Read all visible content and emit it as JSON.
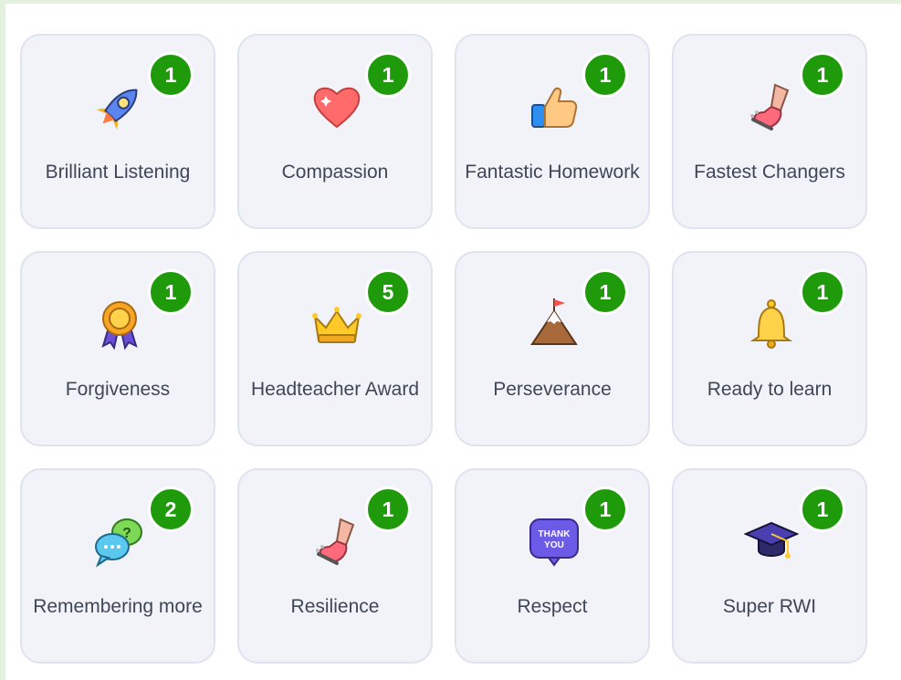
{
  "points": [
    {
      "label": "Brilliant Listening",
      "count": "1",
      "icon": "rocket-icon"
    },
    {
      "label": "Compassion",
      "count": "1",
      "icon": "heart-icon"
    },
    {
      "label": "Fantastic Homework",
      "count": "1",
      "icon": "thumbs-up-icon"
    },
    {
      "label": "Fastest Changers",
      "count": "1",
      "icon": "running-foot-icon"
    },
    {
      "label": "Forgiveness",
      "count": "1",
      "icon": "medal-icon"
    },
    {
      "label": "Headteacher Award",
      "count": "5",
      "icon": "crown-icon"
    },
    {
      "label": "Perseverance",
      "count": "1",
      "icon": "mountain-flag-icon"
    },
    {
      "label": "Ready to learn",
      "count": "1",
      "icon": "bell-icon"
    },
    {
      "label": "Remembering more",
      "count": "2",
      "icon": "speech-bubbles-icon"
    },
    {
      "label": "Resilience",
      "count": "1",
      "icon": "running-foot-icon"
    },
    {
      "label": "Respect",
      "count": "1",
      "icon": "thank-you-sign-icon",
      "icon_text": "THANK YOU"
    },
    {
      "label": "Super RWI",
      "count": "1",
      "icon": "graduation-cap-icon"
    }
  ],
  "colors": {
    "badge": "#1e9a0a",
    "card_bg": "#f1f3f9",
    "card_border": "#dfe3f0",
    "text": "#3f4656"
  }
}
